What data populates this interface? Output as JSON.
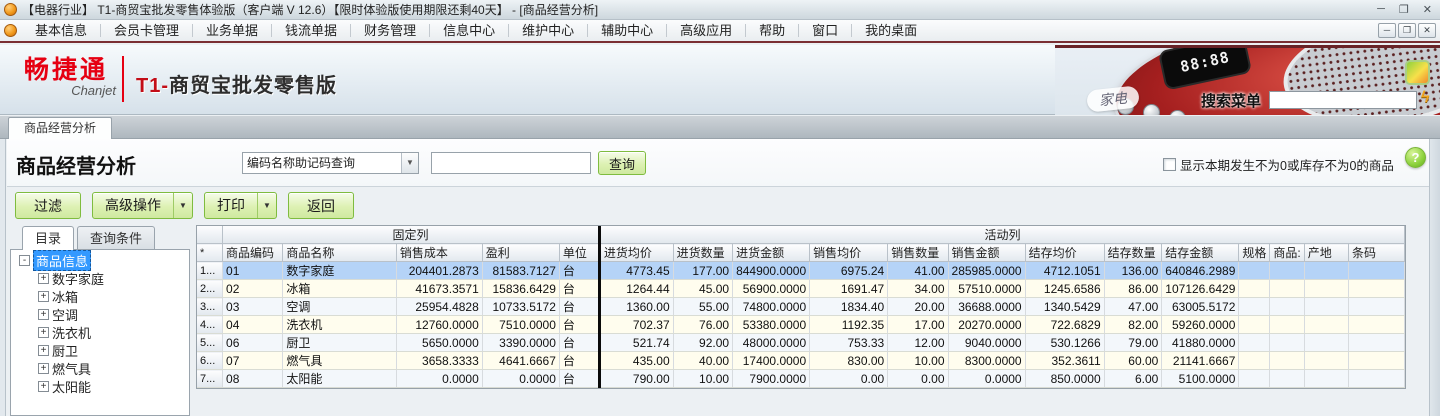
{
  "title_bar": {
    "title": "【电器行业】 T1-商贸宝批发零售体验版（客户端 V 12.6）【限时体验版使用期限还剩40天】 - [商品经营分析]",
    "minimize": "─",
    "restore": "❐",
    "close": "✕"
  },
  "menu_bar": {
    "items": [
      "基本信息",
      "会员卡管理",
      "业务单据",
      "钱流单据",
      "财务管理",
      "信息中心",
      "维护中心",
      "辅助中心",
      "高级应用",
      "帮助",
      "窗口",
      "我的桌面"
    ],
    "minimize": "─",
    "restore": "❐",
    "close": "✕"
  },
  "banner": {
    "logo_cn": "畅捷通",
    "logo_en": "Chanjet",
    "product_prefix": "T1-",
    "product_name": "商贸宝批发零售版",
    "category_bubble": "家电",
    "device_display": "88:88",
    "search_label": "搜索菜单",
    "search_value": "",
    "lightning": "ϟ"
  },
  "tab_bar": {
    "active_tab": "商品经营分析"
  },
  "page_header": {
    "title": "商品经营分析",
    "query_type_value": "编码名称助记码查询",
    "combo_arrow": "▼",
    "query_input_value": "",
    "query_button": "查询",
    "filter_checkbox_label": "显示本期发生不为0或库存不为0的商品",
    "filter_checked": false,
    "help": "?"
  },
  "toolbar": {
    "buttons": [
      {
        "label": "过滤",
        "dropdown": false
      },
      {
        "label": "高级操作",
        "dropdown": true
      },
      {
        "label": "打印",
        "dropdown": true
      },
      {
        "label": "返回",
        "dropdown": false
      }
    ],
    "dropdown_arrow": "▼"
  },
  "sidebar": {
    "tab_catalog": "目录",
    "tab_query": "查询条件",
    "tree_root": "商品信息",
    "tree_children": [
      "数字家庭",
      "冰箱",
      "空调",
      "洗衣机",
      "厨卫",
      "燃气具",
      "太阳能"
    ],
    "collapse_glyph": "-",
    "expand_glyph": "+"
  },
  "table": {
    "corner": "*",
    "group_headers": [
      {
        "label": "固定列",
        "span": 5
      },
      {
        "label": "活动列",
        "span": 13
      }
    ],
    "columns": [
      "商品编码",
      "商品名称",
      "销售成本",
      "盈利",
      "单位",
      "进货均价",
      "进货数量",
      "进货金额",
      "销售均价",
      "销售数量",
      "销售金额",
      "结存均价",
      "结存数量",
      "结存金额",
      "规格",
      "商品:",
      "产地",
      "条码"
    ],
    "rows": [
      {
        "num": "1...",
        "selected": true,
        "cells": [
          "01",
          "数字家庭",
          "204401.2873",
          "81583.7127",
          "台",
          "4773.45",
          "177.00",
          "844900.0000",
          "6975.24",
          "41.00",
          "285985.0000",
          "4712.1051",
          "136.00",
          "640846.2989",
          "",
          "",
          "",
          ""
        ]
      },
      {
        "num": "2...",
        "selected": false,
        "cells": [
          "02",
          "冰箱",
          "41673.3571",
          "15836.6429",
          "台",
          "1264.44",
          "45.00",
          "56900.0000",
          "1691.47",
          "34.00",
          "57510.0000",
          "1245.6586",
          "86.00",
          "107126.6429",
          "",
          "",
          "",
          ""
        ]
      },
      {
        "num": "3...",
        "selected": false,
        "cells": [
          "03",
          "空调",
          "25954.4828",
          "10733.5172",
          "台",
          "1360.00",
          "55.00",
          "74800.0000",
          "1834.40",
          "20.00",
          "36688.0000",
          "1340.5429",
          "47.00",
          "63005.5172",
          "",
          "",
          "",
          ""
        ]
      },
      {
        "num": "4...",
        "selected": false,
        "cells": [
          "04",
          "洗衣机",
          "12760.0000",
          "7510.0000",
          "台",
          "702.37",
          "76.00",
          "53380.0000",
          "1192.35",
          "17.00",
          "20270.0000",
          "722.6829",
          "82.00",
          "59260.0000",
          "",
          "",
          "",
          ""
        ]
      },
      {
        "num": "5...",
        "selected": false,
        "cells": [
          "06",
          "厨卫",
          "5650.0000",
          "3390.0000",
          "台",
          "521.74",
          "92.00",
          "48000.0000",
          "753.33",
          "12.00",
          "9040.0000",
          "530.1266",
          "79.00",
          "41880.0000",
          "",
          "",
          "",
          ""
        ]
      },
      {
        "num": "6...",
        "selected": false,
        "cells": [
          "07",
          "燃气具",
          "3658.3333",
          "4641.6667",
          "台",
          "435.00",
          "40.00",
          "17400.0000",
          "830.00",
          "10.00",
          "8300.0000",
          "352.3611",
          "60.00",
          "21141.6667",
          "",
          "",
          "",
          ""
        ]
      },
      {
        "num": "7...",
        "selected": false,
        "cells": [
          "08",
          "太阳能",
          "0.0000",
          "0.0000",
          "台",
          "790.00",
          "10.00",
          "7900.0000",
          "0.00",
          "0.00",
          "0.0000",
          "850.0000",
          "6.00",
          "5100.0000",
          "",
          "",
          "",
          ""
        ]
      }
    ]
  }
}
